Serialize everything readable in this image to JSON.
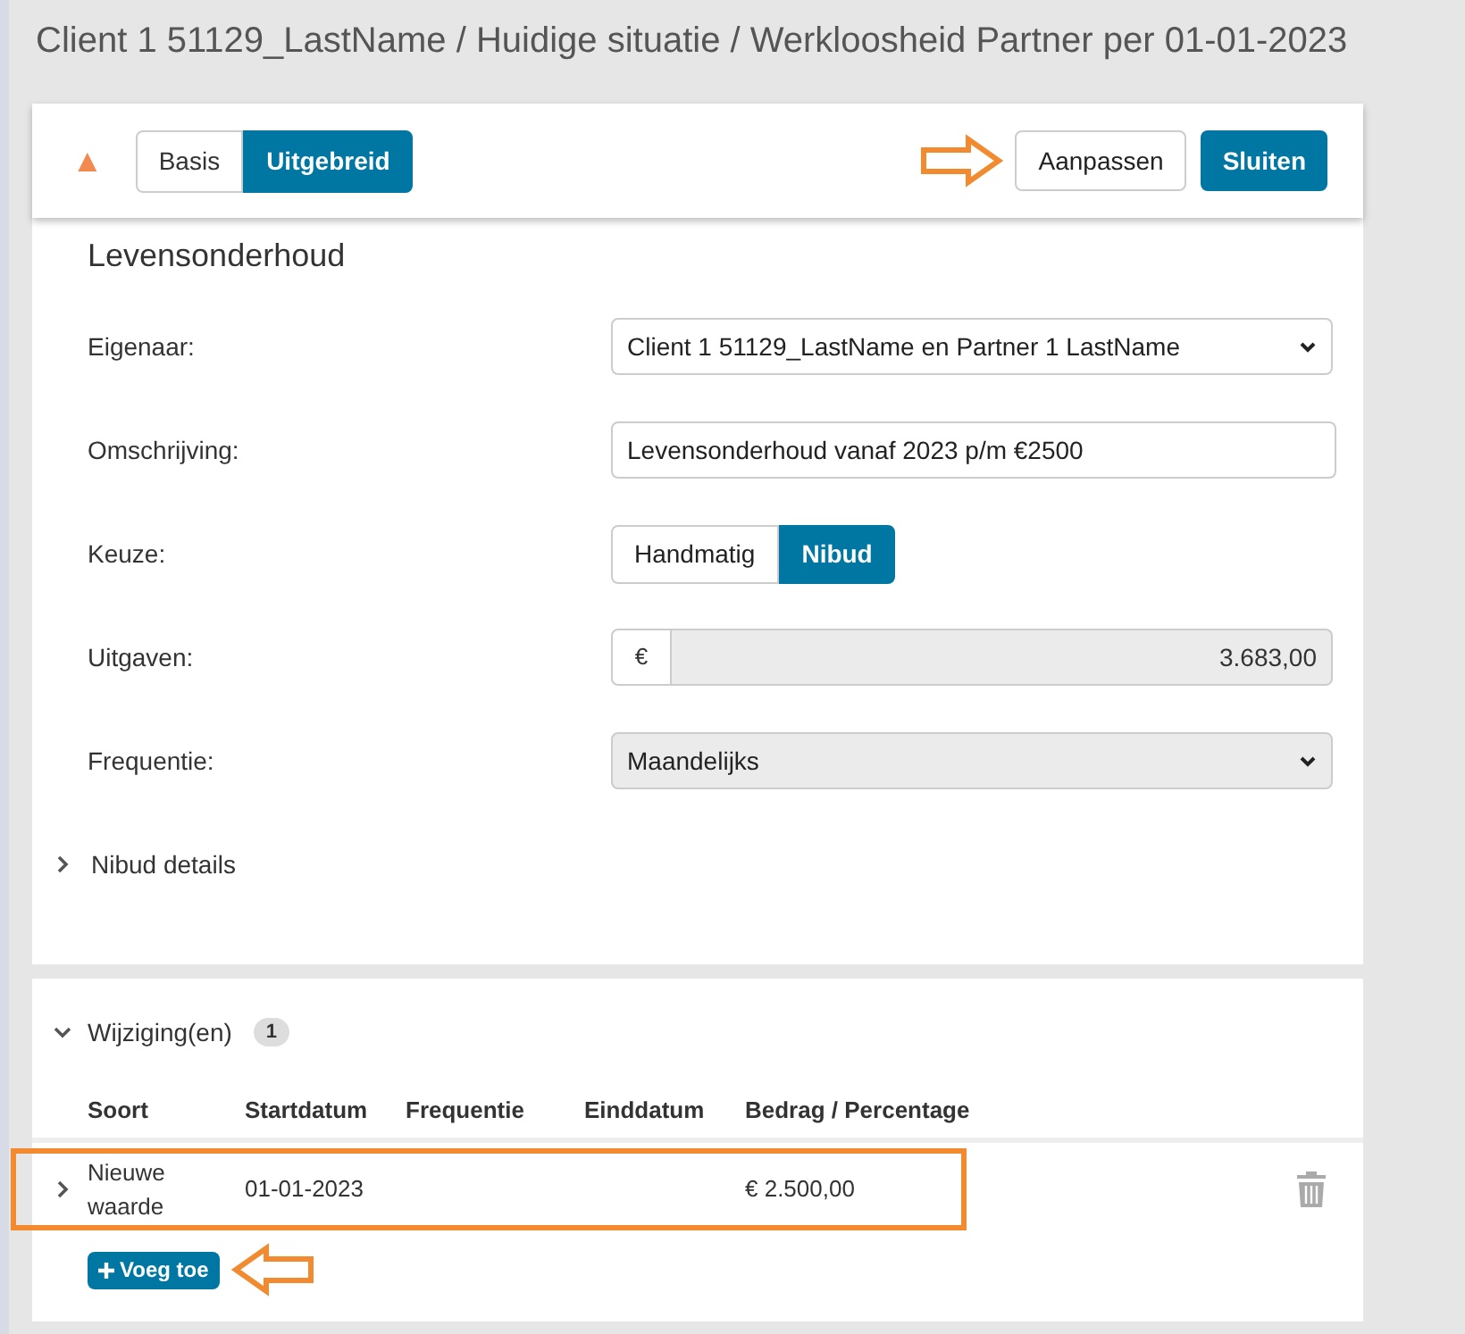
{
  "breadcrumb": "Client 1 51129_LastName / Huidige situatie / Werkloosheid Partner per 01-01-2023",
  "toolbar": {
    "collapsed_icon": "▲",
    "view_tabs": [
      {
        "label": "Basis",
        "selected": false
      },
      {
        "label": "Uitgebreid",
        "selected": true
      }
    ],
    "edit_button": "Aanpassen",
    "close_button": "Sluiten"
  },
  "section_title": "Levensonderhoud",
  "fields": [
    {
      "kind": "select",
      "label": "Eigenaar:",
      "value": "Client 1 51129_LastName en Partner 1 LastName",
      "disabled": false
    },
    {
      "kind": "text",
      "label": "Omschrijving:",
      "value": "Levensonderhoud vanaf 2023 p/m €2500"
    },
    {
      "kind": "toggle",
      "label": "Keuze:",
      "options": [
        {
          "label": "Handmatig",
          "selected": false
        },
        {
          "label": "Nibud",
          "selected": true
        }
      ]
    },
    {
      "kind": "currency",
      "label": "Uitgaven:",
      "prefix": "€",
      "value": "3.683,00",
      "disabled": true
    },
    {
      "kind": "select",
      "label": "Frequentie:",
      "value": "Maandelijks",
      "disabled": true
    }
  ],
  "nibud_details": {
    "label": "Nibud details",
    "expanded": false
  },
  "changes": {
    "title": "Wijziging(en)",
    "count": "1",
    "expanded": true,
    "columns": [
      "Soort",
      "Startdatum",
      "Frequentie",
      "Einddatum",
      "Bedrag / Percentage"
    ],
    "rows": [
      {
        "expanded": false,
        "highlighted": true,
        "cells": [
          "Nieuwe waarde",
          "01-01-2023",
          null,
          null,
          "€ 2.500,00"
        ]
      }
    ],
    "add_button": "Voeg toe"
  }
}
